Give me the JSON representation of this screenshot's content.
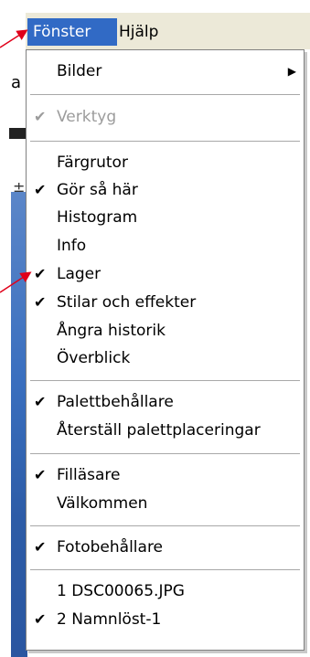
{
  "menubar": {
    "window_menu": "Fönster",
    "help_menu": "Hjälp"
  },
  "background": {
    "partial_text": "a"
  },
  "menu": {
    "items": [
      {
        "label": "Bilder",
        "checked": false,
        "disabled": false,
        "submenu": true
      },
      {
        "label": "Verktyg",
        "checked": true,
        "disabled": true
      },
      {
        "label": "Färgrutor",
        "checked": false
      },
      {
        "label": "Gör så här",
        "checked": true
      },
      {
        "label": "Histogram",
        "checked": false
      },
      {
        "label": "Info",
        "checked": false
      },
      {
        "label": "Lager",
        "checked": true
      },
      {
        "label": "Stilar och effekter",
        "checked": true
      },
      {
        "label": "Ångra historik",
        "checked": false
      },
      {
        "label": "Överblick",
        "checked": false
      },
      {
        "label": "Palettbehållare",
        "checked": true
      },
      {
        "label": "Återställ palettplaceringar",
        "checked": false
      },
      {
        "label": "Filläsare",
        "checked": true
      },
      {
        "label": "Välkommen",
        "checked": false
      },
      {
        "label": "Fotobehållare",
        "checked": true
      },
      {
        "label": "1 DSC00065.JPG",
        "checked": false
      },
      {
        "label": "2 Namnlöst-1",
        "checked": true
      }
    ]
  },
  "colors": {
    "highlight": "#316ac5",
    "annotation": "#e0001a"
  },
  "icons": {
    "check": "checkmark-icon",
    "submenu": "submenu-arrow-icon"
  }
}
